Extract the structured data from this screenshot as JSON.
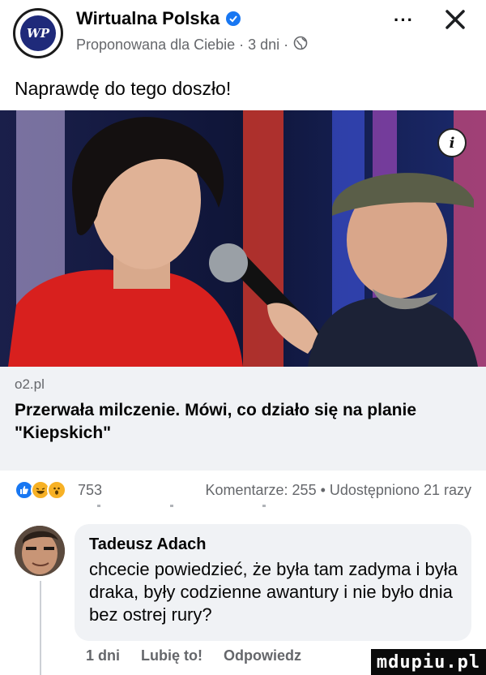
{
  "header": {
    "page_name": "Wirtualna Polska",
    "avatar_text": "WP",
    "meta_text": "Proponowana dla Ciebie · 3 dni ·",
    "more_label": "···"
  },
  "post": {
    "text": "Naprawdę do tego doszło!"
  },
  "link": {
    "domain": "o2.pl",
    "title": "Przerwała milczenie. Mówi, co działo się na planie \"Kiepskich\""
  },
  "stats": {
    "reaction_count": "753",
    "comments_shares": "Komentarze: 255 • Udostępniono 21 razy"
  },
  "comment": {
    "author": "Tadeusz Adach",
    "text": "chcecie powiedzieć, że była tam zadyma i była draka, były codzienne awantury i nie było dnia bez ostrej rury?",
    "time": "1 dni",
    "like_label": "Lubię to!",
    "reply_label": "Odpowiedz"
  },
  "watermark": "mdupiu.pl",
  "colors": {
    "accent": "#1877f2",
    "secondary_text": "#65676b",
    "bubble_bg": "#f0f2f5"
  }
}
